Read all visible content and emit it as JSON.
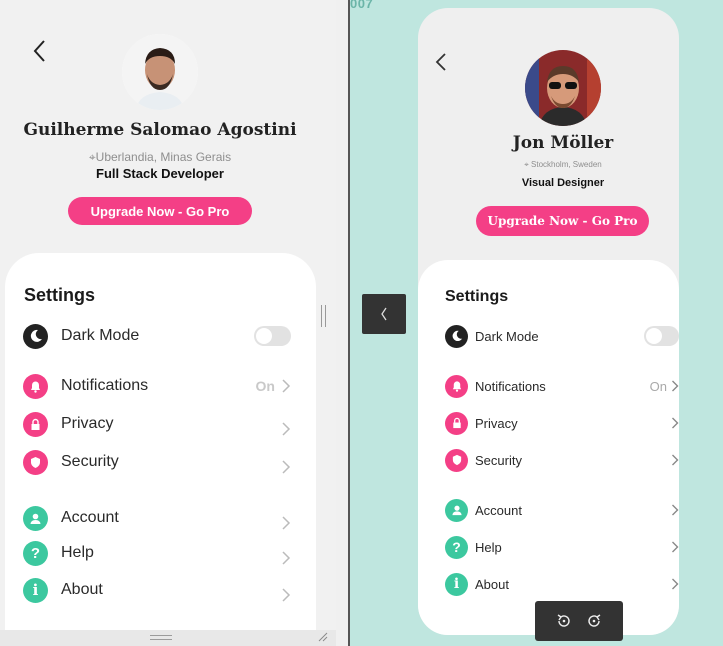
{
  "left": {
    "name": "Guilherme Salomao Agostini",
    "location": "Uberlandia, Minas Gerais",
    "role": "Full Stack Developer",
    "cta": "Upgrade Now - Go Pro",
    "settings_title": "Settings",
    "items": [
      {
        "label": "Dark Mode",
        "icon": "moon-icon",
        "type": "toggle",
        "color": "#222222"
      },
      {
        "label": "Notifications",
        "icon": "bell-icon",
        "value": "On",
        "color": "#f43f86"
      },
      {
        "label": "Privacy",
        "icon": "lock-icon",
        "color": "#f43f86"
      },
      {
        "label": "Security",
        "icon": "shield-icon",
        "color": "#f43f86"
      },
      {
        "label": "Account",
        "icon": "user-icon",
        "color": "#3cc89f"
      },
      {
        "label": "Help",
        "icon": "question-icon",
        "color": "#3cc89f"
      },
      {
        "label": "About",
        "icon": "info-icon",
        "color": "#3cc89f"
      }
    ]
  },
  "right": {
    "corner_text": "007",
    "name": "Jon Möller",
    "location": "Stockholm, Sweden",
    "role": "Visual Designer",
    "cta": "Upgrade Now - Go Pro",
    "settings_title": "Settings",
    "items": [
      {
        "label": "Dark Mode",
        "icon": "moon-icon",
        "type": "toggle"
      },
      {
        "label": "Notifications",
        "icon": "bell-icon",
        "value": "On"
      },
      {
        "label": "Privacy",
        "icon": "lock-icon"
      },
      {
        "label": "Security",
        "icon": "shield-icon"
      },
      {
        "label": "Account",
        "icon": "user-icon"
      },
      {
        "label": "Help",
        "icon": "question-icon"
      },
      {
        "label": "About",
        "icon": "info-icon"
      }
    ]
  },
  "colors": {
    "accent_pink": "#f43f86",
    "accent_green": "#3cc89f",
    "backdrop": "#bfe6df"
  }
}
